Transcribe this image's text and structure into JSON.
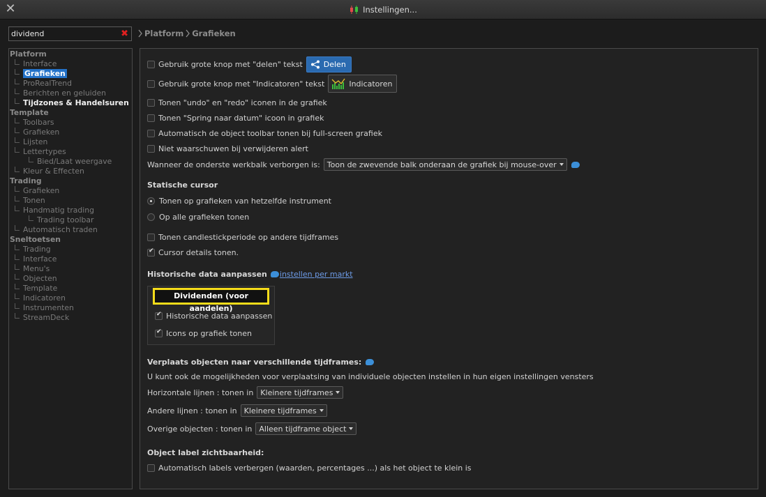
{
  "window": {
    "title": "Instellingen...",
    "close_icon": "close-icon"
  },
  "search": {
    "value": "dividend",
    "placeholder": ""
  },
  "breadcrumb": [
    "Platform",
    "Grafieken"
  ],
  "tree": [
    {
      "label": "Platform",
      "level": 0
    },
    {
      "label": "Interface",
      "level": 1
    },
    {
      "label": "Grafieken",
      "level": 1,
      "selected": true
    },
    {
      "label": "ProRealTrend",
      "level": 1
    },
    {
      "label": "Berichten en geluiden",
      "level": 1
    },
    {
      "label": "Tijdzones & Handelsuren",
      "level": 1,
      "bold": true
    },
    {
      "label": "Template",
      "level": 0
    },
    {
      "label": "Toolbars",
      "level": 1
    },
    {
      "label": "Grafieken",
      "level": 1
    },
    {
      "label": "Lijsten",
      "level": 1
    },
    {
      "label": "Lettertypes",
      "level": 1
    },
    {
      "label": "Bied/Laat weergave",
      "level": 2
    },
    {
      "label": "Kleur & Effecten",
      "level": 1
    },
    {
      "label": "Trading",
      "level": 0
    },
    {
      "label": "Grafieken",
      "level": 1
    },
    {
      "label": "Tonen",
      "level": 1
    },
    {
      "label": "Handmatig trading",
      "level": 1
    },
    {
      "label": "Trading toolbar",
      "level": 2
    },
    {
      "label": "Automatisch traden",
      "level": 1
    },
    {
      "label": "Sneltoetsen",
      "level": 0
    },
    {
      "label": "Trading",
      "level": 1
    },
    {
      "label": "Interface",
      "level": 1
    },
    {
      "label": "Menu's",
      "level": 1
    },
    {
      "label": "Objecten",
      "level": 1
    },
    {
      "label": "Template",
      "level": 1
    },
    {
      "label": "Indicatoren",
      "level": 1
    },
    {
      "label": "Instrumenten",
      "level": 1
    },
    {
      "label": "StreamDeck",
      "level": 1
    }
  ],
  "main": {
    "opt_share_btn": {
      "label": "Gebruik grote knop met \"delen\" tekst",
      "checked": false,
      "button": "Delen"
    },
    "opt_ind_btn": {
      "label": "Gebruik grote knop met \"Indicatoren\" tekst",
      "checked": false,
      "button": "Indicatoren"
    },
    "opt_undo": {
      "label": "Tonen \"undo\" en \"redo\" iconen in de grafiek",
      "checked": false
    },
    "opt_jump": {
      "label": "Tonen \"Spring naar datum\" icoon in grafiek",
      "checked": false
    },
    "opt_toolbar": {
      "label": "Automatisch de object toolbar tonen bij full-screen grafiek",
      "checked": false
    },
    "opt_warn": {
      "label": "Niet waarschuwen bij verwijderen alert",
      "checked": false
    },
    "bottom_bar": {
      "label": "Wanneer de onderste werkbalk verborgen is:",
      "value": "Toon de zwevende balk onderaan de grafiek bij mouse-over"
    },
    "static_cursor": {
      "heading": "Statische cursor",
      "radio1": "Tonen op grafieken van hetzelfde instrument",
      "radio2": "Op alle grafieken tonen",
      "selected": 1
    },
    "opt_candle": {
      "label": "Tonen candlestickperiode op andere tijdframes",
      "checked": false
    },
    "opt_cursor_details": {
      "label": "Cursor details tonen.",
      "checked": true
    },
    "historic": {
      "heading": "Historische data aanpassen",
      "link": "instellen per markt",
      "tab": "Dividenden (voor aandelen)",
      "opt1": {
        "label": "Historische data aanpassen",
        "checked": true
      },
      "opt2": {
        "label": "Icons op grafiek tonen",
        "checked": true
      }
    },
    "move_objects": {
      "heading": "Verplaats objecten naar verschillende tijdframes:",
      "desc": "U kunt ook de mogelijkheden voor verplaatsing van individuele objecten instellen in hun eigen instellingen vensters",
      "horizontal": {
        "label": "Horizontale lijnen : tonen in",
        "value": "Kleinere tijdframes"
      },
      "other_lines": {
        "label": "Andere lijnen : tonen in",
        "value": "Kleinere tijdframes"
      },
      "other_objects": {
        "label": "Overige objecten : tonen in",
        "value": "Alleen tijdframe object"
      }
    },
    "object_label": {
      "heading": "Object label zichtbaarheid:",
      "opt": {
        "label": "Automatisch labels verbergen (waarden, percentages ...) als het object te klein is",
        "checked": false
      }
    }
  },
  "colors": {
    "accent": "#2472c8",
    "highlight": "#f5dc1a",
    "share_button": "#2a6ab0"
  }
}
